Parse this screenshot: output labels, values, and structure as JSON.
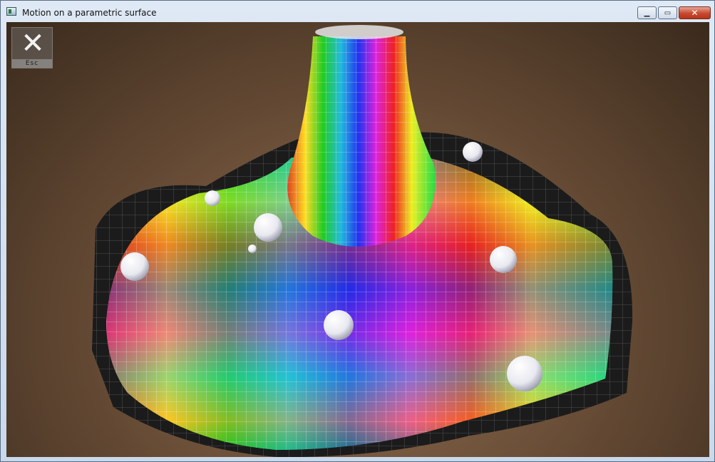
{
  "window": {
    "title": "Motion on a parametric surface",
    "minimize_icon": "minimize-icon",
    "maximize_icon": "maximize-icon",
    "close_icon": "close-icon"
  },
  "overlay": {
    "exit_button_label": "Esc",
    "exit_icon": "close-x-icon"
  },
  "scene": {
    "sphere_count": 8,
    "colors": {
      "ground": "#7a5a40",
      "surface_border": "#1a1a1a",
      "grid_lines": "#ffffff",
      "spheres": "#ffffff"
    }
  }
}
